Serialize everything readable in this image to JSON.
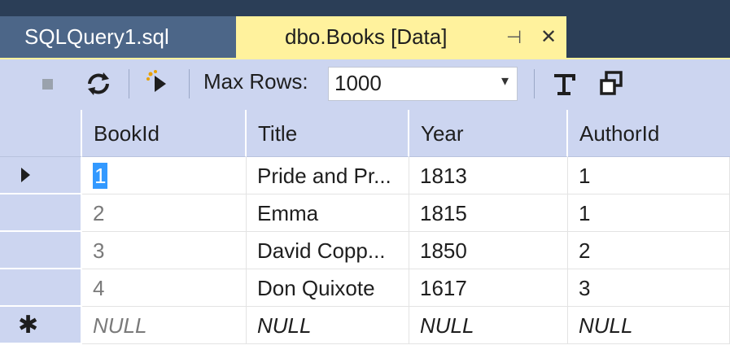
{
  "tabs": {
    "inactive_label": "SQLQuery1.sql",
    "active_label": "dbo.Books [Data]",
    "pin_glyph": "⊣",
    "close_glyph": "✕"
  },
  "toolbar": {
    "max_rows_label": "Max Rows:",
    "max_rows_value": "1000",
    "dropdown_glyph": "▾"
  },
  "grid": {
    "columns": [
      "BookId",
      "Title",
      "Year",
      "AuthorId"
    ],
    "rows": [
      {
        "BookId": "1",
        "Title": "Pride and Pr...",
        "Year": "1813",
        "AuthorId": "1"
      },
      {
        "BookId": "2",
        "Title": "Emma",
        "Year": "1815",
        "AuthorId": "1"
      },
      {
        "BookId": "3",
        "Title": "David Copp...",
        "Year": "1850",
        "AuthorId": "2"
      },
      {
        "BookId": "4",
        "Title": "Don Quixote",
        "Year": "1617",
        "AuthorId": "3"
      }
    ],
    "new_row": {
      "BookId": "NULL",
      "Title": "NULL",
      "Year": "NULL",
      "AuthorId": "NULL"
    },
    "new_row_glyph": "✱"
  },
  "colors": {
    "tabbar_bg": "#2b3e57",
    "active_tab": "#fff29d",
    "toolbar_bg": "#ccd5f0",
    "selection": "#3399ff"
  }
}
